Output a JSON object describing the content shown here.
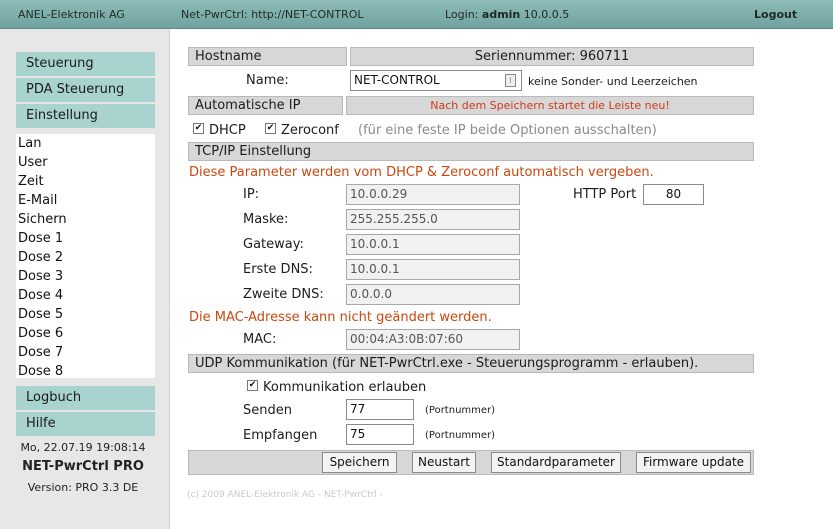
{
  "topbar": {
    "company": "ANEL-Elektronik AG",
    "device": "Net-PwrCtrl: http://NET-CONTROL",
    "login_prefix": "Login: ",
    "login_user": "admin",
    "login_ip": " 10.0.0.5",
    "logout": "Logout"
  },
  "sidebar": {
    "nav": {
      "steuerung": "Steuerung",
      "pda": "PDA Steuerung",
      "einstellung": "Einstellung",
      "logbuch": "Logbuch",
      "hilfe": "Hilfe"
    },
    "submenu": [
      "Lan",
      "User",
      "Zeit",
      "E-Mail",
      "Sichern",
      "Dose 1",
      "Dose 2",
      "Dose 3",
      "Dose 4",
      "Dose 5",
      "Dose 6",
      "Dose 7",
      "Dose 8"
    ],
    "datetime": "Mo, 22.07.19 19:08:14",
    "product": "NET-PwrCtrl PRO",
    "version": "Version: PRO 3.3 DE"
  },
  "form": {
    "hostname_header": "Hostname",
    "serial": "Seriennummer: 960711",
    "name_label": "Name:",
    "name_value": "NET-CONTROL",
    "name_hint": "keine Sonder- und Leerzeichen",
    "auto_ip_header": "Automatische IP",
    "restart_notice": "Nach dem Speichern startet die Leiste neu!",
    "dhcp_label": "DHCP",
    "dhcp_checked": true,
    "zeroconf_label": "Zeroconf",
    "zeroconf_checked": true,
    "fixed_ip_hint": "(für eine feste IP beide Optionen ausschalten)",
    "tcpip_header": "TCP/IP Einstellung",
    "dhcp_notice": "Diese Parameter werden vom DHCP & Zeroconf automatisch vergeben.",
    "ip_label": "IP:",
    "ip_value": "10.0.0.29",
    "http_port_label": "HTTP Port",
    "http_port_value": "80",
    "mask_label": "Maske:",
    "mask_value": "255.255.255.0",
    "gateway_label": "Gateway:",
    "gateway_value": "10.0.0.1",
    "dns1_label": "Erste DNS:",
    "dns1_value": "10.0.0.1",
    "dns2_label": "Zweite DNS:",
    "dns2_value": "0.0.0.0",
    "mac_notice": "Die MAC-Adresse kann nicht geändert werden.",
    "mac_label": "MAC:",
    "mac_value": "00:04:A3:0B:07:60",
    "udp_header": "UDP Kommunikation (für NET-PwrCtrl.exe - Steuerungsprogramm - erlauben).",
    "udp_allow_label": "Kommunikation erlauben",
    "udp_allow_checked": true,
    "send_label": "Senden",
    "send_value": "77",
    "receive_label": "Empfangen",
    "receive_value": "75",
    "port_hint": "(Portnummer)",
    "buttons": {
      "save": "Speichern",
      "restart": "Neustart",
      "defaults": "Standardparameter",
      "firmware": "Firmware update"
    }
  },
  "footer": "(c) 2009 ANEL-Elektronik AG - NET-PwrCtrl -",
  "colors": {
    "topbar": "#7fb1ad",
    "nav_button": "#a9d3cf",
    "section_bar": "#d7d7d7",
    "notice_red": "#c9480f"
  }
}
